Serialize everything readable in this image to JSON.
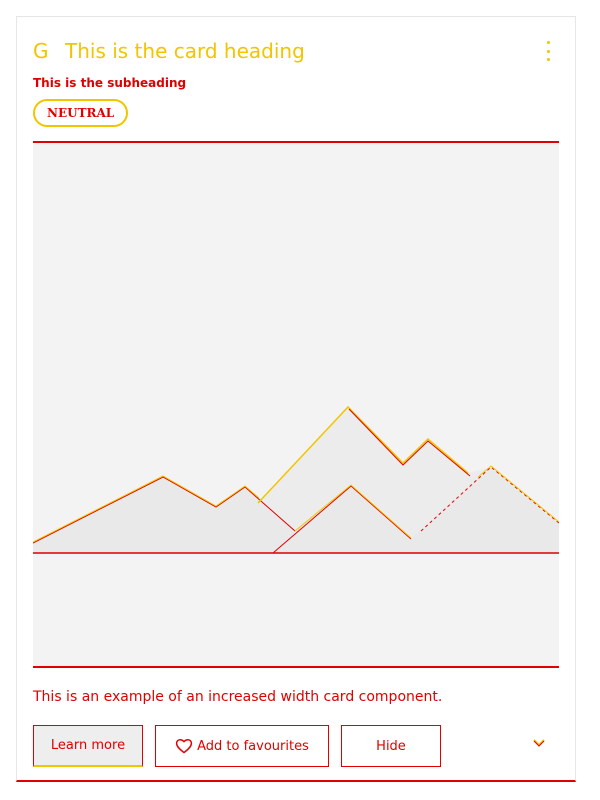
{
  "card": {
    "icon_glyph": "G",
    "heading": "This is the card heading",
    "subheading": "This is the subheading",
    "badge": "NEUTRAL",
    "description": "This is an example of an increased width card component.",
    "buttons": {
      "learn_more": "Learn more",
      "add_favourites": "Add to favourites",
      "hide": "Hide"
    }
  },
  "icons": {
    "brand": "g-icon",
    "menu": "vertical-ellipsis-icon",
    "favourite": "heart-icon",
    "expand": "chevron-down-icon"
  },
  "colors": {
    "accent_red": "#e00000",
    "accent_yellow": "#f2c500",
    "placeholder_bg": "#f3f3f3",
    "mountain_fill": "#e8e8e8"
  }
}
